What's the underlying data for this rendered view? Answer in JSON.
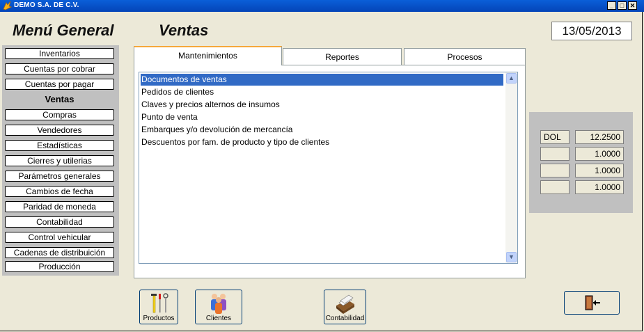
{
  "window": {
    "title": "DEMO  S.A. DE C.V."
  },
  "header": {
    "menu_title": "Menú General",
    "section_title": "Ventas",
    "date": "13/05/2013"
  },
  "sidebar": {
    "items": [
      {
        "label": "Inventarios"
      },
      {
        "label": "Cuentas por cobrar"
      },
      {
        "label": "Cuentas por pagar"
      },
      {
        "label": "Ventas",
        "active": true
      },
      {
        "label": "Compras"
      },
      {
        "label": "Vendedores"
      },
      {
        "label": "Estadísticas"
      },
      {
        "label": "Cierres y utilerias"
      },
      {
        "label": "Parámetros generales"
      },
      {
        "label": "Cambios de fecha"
      },
      {
        "label": "Paridad de moneda"
      },
      {
        "label": "Contabilidad"
      },
      {
        "label": "Control vehicular"
      },
      {
        "label": "Cadenas de distribuición"
      },
      {
        "label": "Producción"
      }
    ]
  },
  "tabs": [
    {
      "label": "Mantenimientos",
      "active": true
    },
    {
      "label": "Reportes"
    },
    {
      "label": "Procesos"
    }
  ],
  "list": {
    "items": [
      {
        "label": "Documentos de ventas",
        "selected": true
      },
      {
        "label": "Pedidos de clientes"
      },
      {
        "label": "Claves y precios alternos de insumos"
      },
      {
        "label": "Punto de venta"
      },
      {
        "label": "Embarques y/o devolución de mercancía"
      },
      {
        "label": "Descuentos por fam. de producto y tipo de clientes"
      }
    ]
  },
  "rates": {
    "rows": [
      {
        "code": "DOL",
        "value": "12.2500"
      },
      {
        "code": "",
        "value": "1.0000"
      },
      {
        "code": "",
        "value": "1.0000"
      },
      {
        "code": "",
        "value": "1.0000"
      }
    ]
  },
  "shortcuts": {
    "productos": {
      "label": "Productos",
      "icon": "tools-icon"
    },
    "clientes": {
      "label": "Clientes",
      "icon": "people-icon"
    },
    "contabilidad": {
      "label": "Contabilidad",
      "icon": "card-file-icon"
    },
    "exit": {
      "icon": "exit-door-icon"
    }
  },
  "colors": {
    "titlebar": "#0A5FD8",
    "selection": "#316AC5",
    "tab_accent": "#F6A83A",
    "window_bg": "#ECE9D8",
    "panel_gray": "#C0C0C0"
  }
}
